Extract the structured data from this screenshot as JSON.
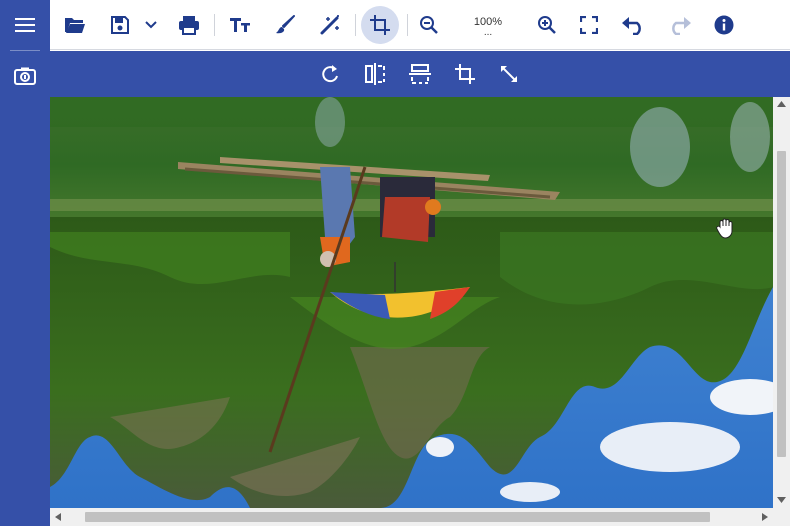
{
  "sidebar": {
    "menu_icon": "hamburger-menu-icon",
    "snapshot_icon": "camera-icon"
  },
  "toolbar": {
    "open_icon": "folder-open-icon",
    "save_icon": "save-icon",
    "save_dropdown_icon": "chevron-down-icon",
    "print_icon": "print-icon",
    "text_icon": "text-icon",
    "brush_icon": "brush-icon",
    "magic_wand_icon": "magic-wand-icon",
    "crop_icon": "crop-icon",
    "zoom_out_icon": "zoom-out-icon",
    "zoom_value": "100%",
    "zoom_more": "...",
    "zoom_in_icon": "zoom-in-icon",
    "fit_icon": "fit-screen-icon",
    "undo_icon": "undo-icon",
    "redo_icon": "redo-icon",
    "info_icon": "info-icon"
  },
  "crop_toolbar": {
    "rotate_icon": "rotate-icon",
    "flip_horizontal_icon": "flip-horizontal-icon",
    "flip_vertical_icon": "flip-vertical-icon",
    "crop_icon": "crop-icon",
    "resize_icon": "resize-icon"
  },
  "colors": {
    "brand": "#3550a8",
    "active_button": "#d4dcef",
    "icon_dark": "#1f3b8c"
  }
}
